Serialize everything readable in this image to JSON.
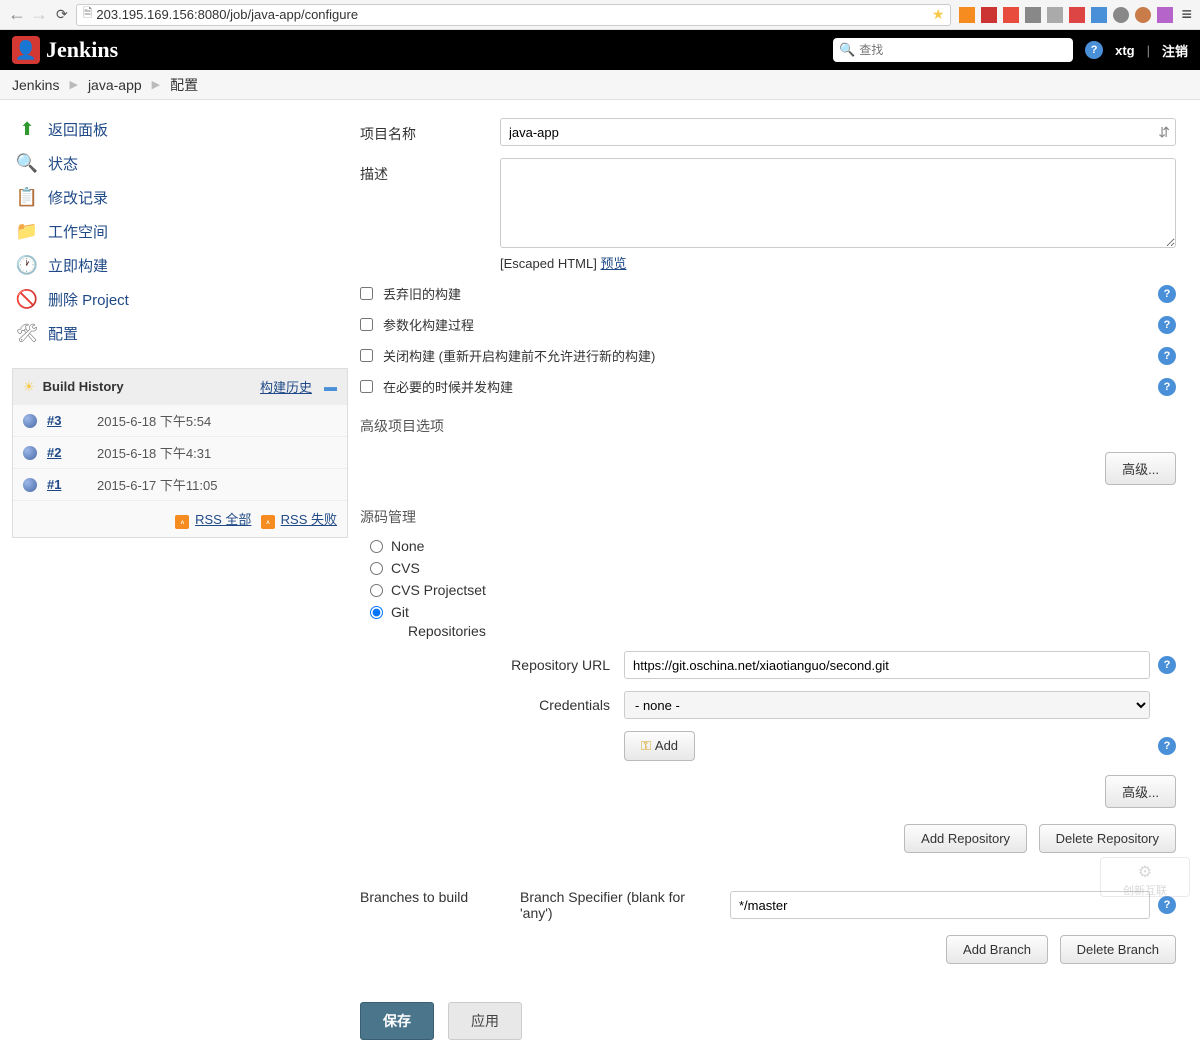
{
  "browser": {
    "url": "203.195.169.156:8080/job/java-app/configure"
  },
  "header": {
    "brand": "Jenkins",
    "search_placeholder": "查找",
    "user": "xtg",
    "logout": "注销"
  },
  "breadcrumbs": [
    "Jenkins",
    "java-app",
    "配置"
  ],
  "sidebar": {
    "tasks": [
      {
        "label": "返回面板",
        "icon": "⬆",
        "color": "#2e9a2e"
      },
      {
        "label": "状态",
        "icon": "🔍",
        "color": "#4a90d9"
      },
      {
        "label": "修改记录",
        "icon": "📋",
        "color": "#c08030"
      },
      {
        "label": "工作空间",
        "icon": "📁",
        "color": "#8898b8"
      },
      {
        "label": "立即构建",
        "icon": "🕐",
        "color": "#2e9a2e"
      },
      {
        "label": "删除 Project",
        "icon": "🚫",
        "color": "#cc3333"
      },
      {
        "label": "配置",
        "icon": "🛠",
        "color": "#888"
      }
    ],
    "build_history": {
      "title": "Build History",
      "trend_label": "构建历史",
      "builds": [
        {
          "num": "#3",
          "date": "2015-6-18 下午5:54"
        },
        {
          "num": "#2",
          "date": "2015-6-18 下午4:31"
        },
        {
          "num": "#1",
          "date": "2015-6-17 下午11:05"
        }
      ],
      "rss_all": "RSS 全部",
      "rss_fail": "RSS 失败"
    }
  },
  "form": {
    "project_name_label": "项目名称",
    "project_name_value": "java-app",
    "description_label": "描述",
    "description_value": "",
    "escaped_html": "[Escaped HTML]",
    "preview": "预览",
    "checkboxes": [
      "丢弃旧的构建",
      "参数化构建过程",
      "关闭构建 (重新开启构建前不允许进行新的构建)",
      "在必要的时候并发构建"
    ],
    "advanced_options_label": "高级项目选项",
    "advanced_btn": "高级...",
    "scm_label": "源码管理",
    "scm_options": [
      "None",
      "CVS",
      "CVS Projectset",
      "Git"
    ],
    "scm_selected": "Git",
    "repositories_label": "Repositories",
    "repo_url_label": "Repository URL",
    "repo_url_value": "https://git.oschina.net/xiaotianguo/second.git",
    "credentials_label": "Credentials",
    "credentials_value": "- none -",
    "add_btn": "Add",
    "add_repo_btn": "Add Repository",
    "delete_repo_btn": "Delete Repository",
    "branches_label": "Branches to build",
    "branch_spec_label": "Branch Specifier (blank for 'any')",
    "branch_spec_value": "*/master",
    "add_branch_btn": "Add Branch",
    "delete_branch_btn": "Delete Branch",
    "save_btn": "保存",
    "apply_btn": "应用"
  },
  "watermark": "创新互联"
}
